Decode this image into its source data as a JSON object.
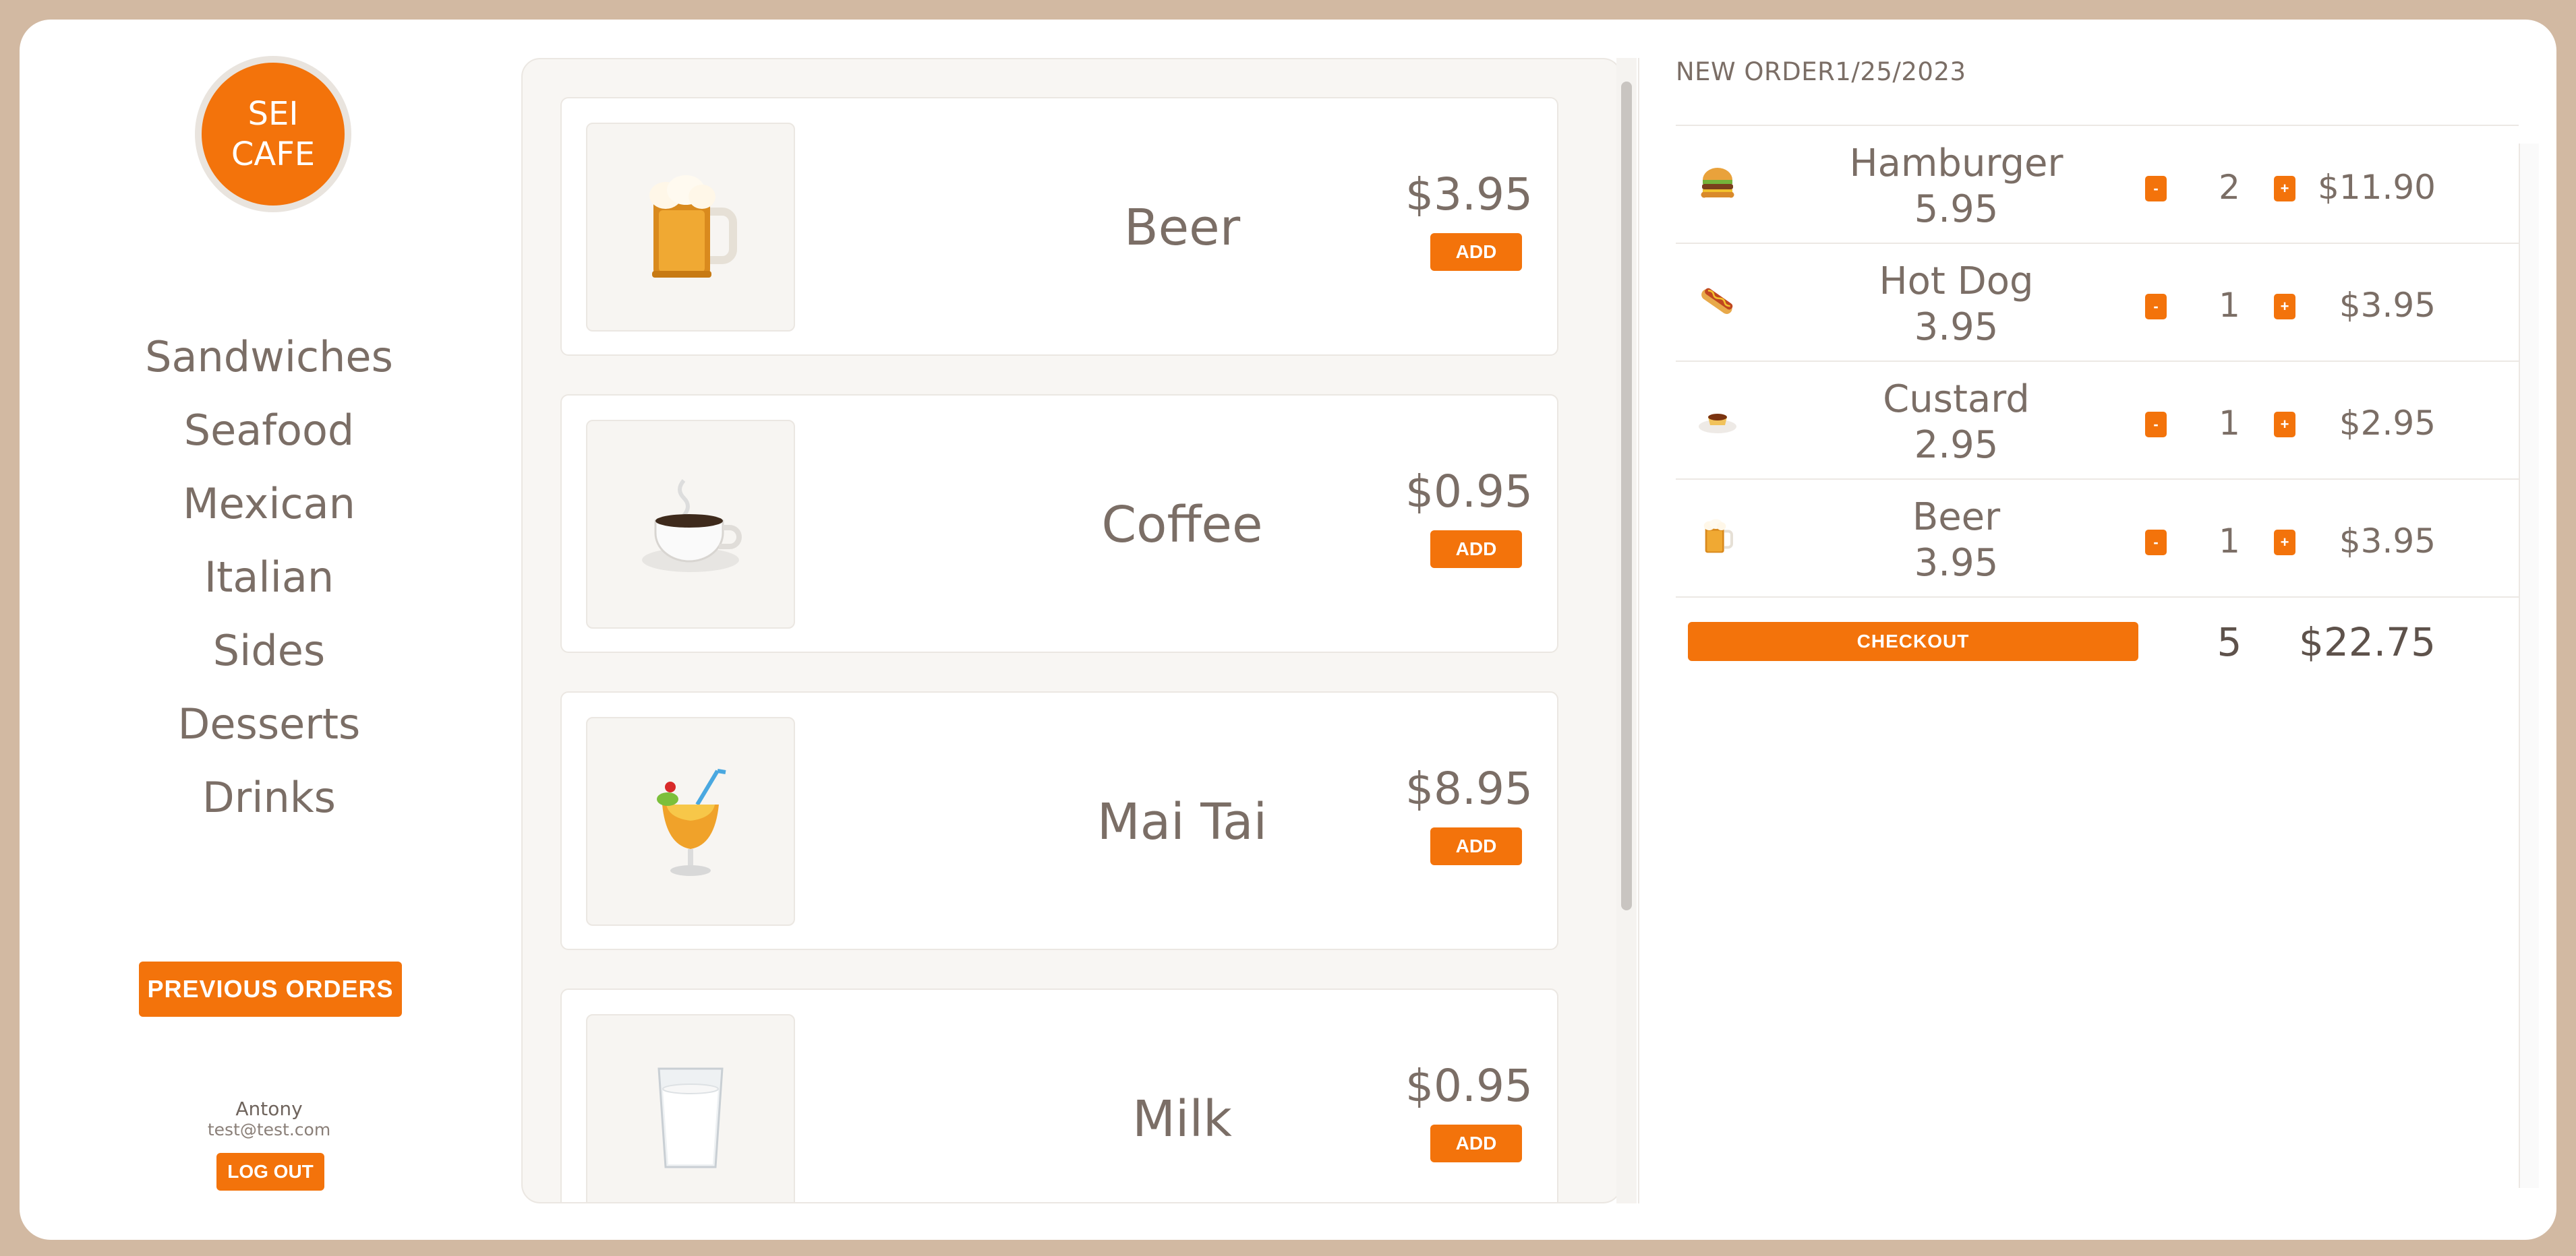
{
  "brand": {
    "line1": "SEI",
    "line2": "CAFE",
    "color": "#f3730b"
  },
  "categories": [
    "Sandwiches",
    "Seafood",
    "Mexican",
    "Italian",
    "Sides",
    "Desserts",
    "Drinks"
  ],
  "previous_orders_label": "PREVIOUS ORDERS",
  "user": {
    "name": "Antony",
    "email": "test@test.com",
    "logout_label": "LOG OUT"
  },
  "menu": {
    "items": [
      {
        "name": "Beer",
        "price": "$3.95",
        "add_label": "ADD",
        "icon": "beer-mug-icon"
      },
      {
        "name": "Coffee",
        "price": "$0.95",
        "add_label": "ADD",
        "icon": "coffee-cup-icon"
      },
      {
        "name": "Mai Tai",
        "price": "$8.95",
        "add_label": "ADD",
        "icon": "tropical-drink-icon"
      },
      {
        "name": "Milk",
        "price": "$0.95",
        "add_label": "ADD",
        "icon": "milk-glass-icon"
      }
    ]
  },
  "order": {
    "title": "NEW ORDER1/25/2023",
    "lines": [
      {
        "name": "Hamburger",
        "unit_price": "5.95",
        "qty": "2",
        "total": "$11.90",
        "icon": "hamburger-icon",
        "minus": "-",
        "plus": "+"
      },
      {
        "name": "Hot Dog",
        "unit_price": "3.95",
        "qty": "1",
        "total": "$3.95",
        "icon": "hot-dog-icon",
        "minus": "-",
        "plus": "+"
      },
      {
        "name": "Custard",
        "unit_price": "2.95",
        "qty": "1",
        "total": "$2.95",
        "icon": "custard-icon",
        "minus": "-",
        "plus": "+"
      },
      {
        "name": "Beer",
        "unit_price": "3.95",
        "qty": "1",
        "total": "$3.95",
        "icon": "beer-mug-icon",
        "minus": "-",
        "plus": "+"
      }
    ],
    "checkout_label": "CHECKOUT",
    "total_qty": "5",
    "total_price": "$22.75"
  }
}
